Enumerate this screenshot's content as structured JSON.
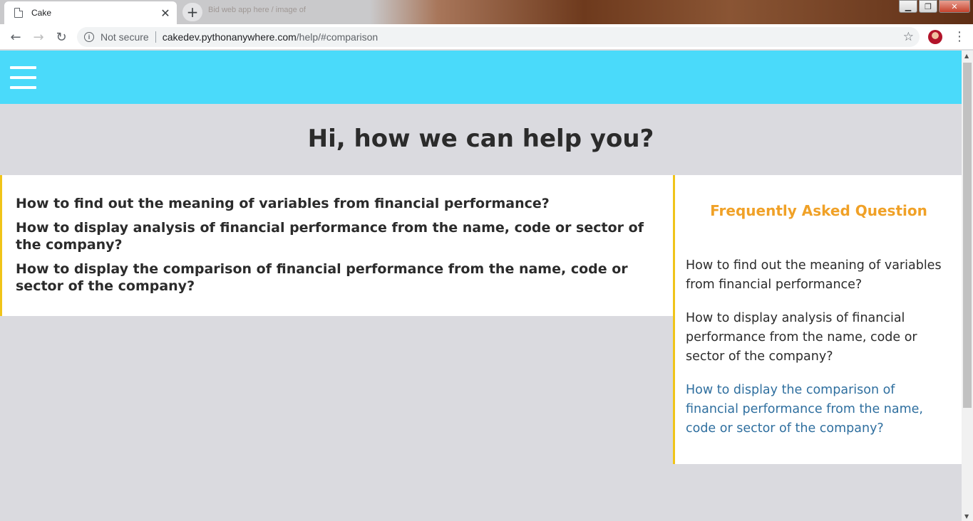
{
  "browser": {
    "tab_title": "Cake",
    "tab_close": "✕",
    "new_tab": "+",
    "bg_tab_title": "Bid web app here / image of",
    "not_secure": "Not secure",
    "url_host": "cakedev.pythonanywhere.com",
    "url_path": "/help/#comparison",
    "back": "←",
    "forward": "→",
    "reload": "↻",
    "star": "☆",
    "menu": "⋮",
    "win_min": "▁",
    "win_restore": "❐",
    "win_close": "✕"
  },
  "page": {
    "hero_title": "Hi, how we can help you?",
    "questions": [
      "How to find out the meaning of variables from financial performance?",
      "How to display analysis of financial performance from the name, code or sector of the company?",
      "How to display the comparison of financial performance from the name, code or sector of the company?"
    ],
    "faq": {
      "title": "Frequently Asked Question",
      "links": [
        "How to find out the meaning of variables from financial performance?",
        "How to display analysis of financial performance from the name, code or sector of the company?",
        "How to display the comparison of financial performance from the name, code or sector of the company?"
      ]
    }
  },
  "colors": {
    "header": "#4adafa",
    "accent_border": "#f0c419",
    "faq_title": "#f0a127",
    "active_link": "#2f6f9f",
    "page_bg": "#dadadf"
  },
  "icons": [
    "page-icon",
    "close-icon",
    "plus-icon",
    "back-icon",
    "forward-icon",
    "reload-icon",
    "info-icon",
    "star-icon",
    "avatar",
    "menu-dots-icon",
    "hamburger-icon"
  ]
}
